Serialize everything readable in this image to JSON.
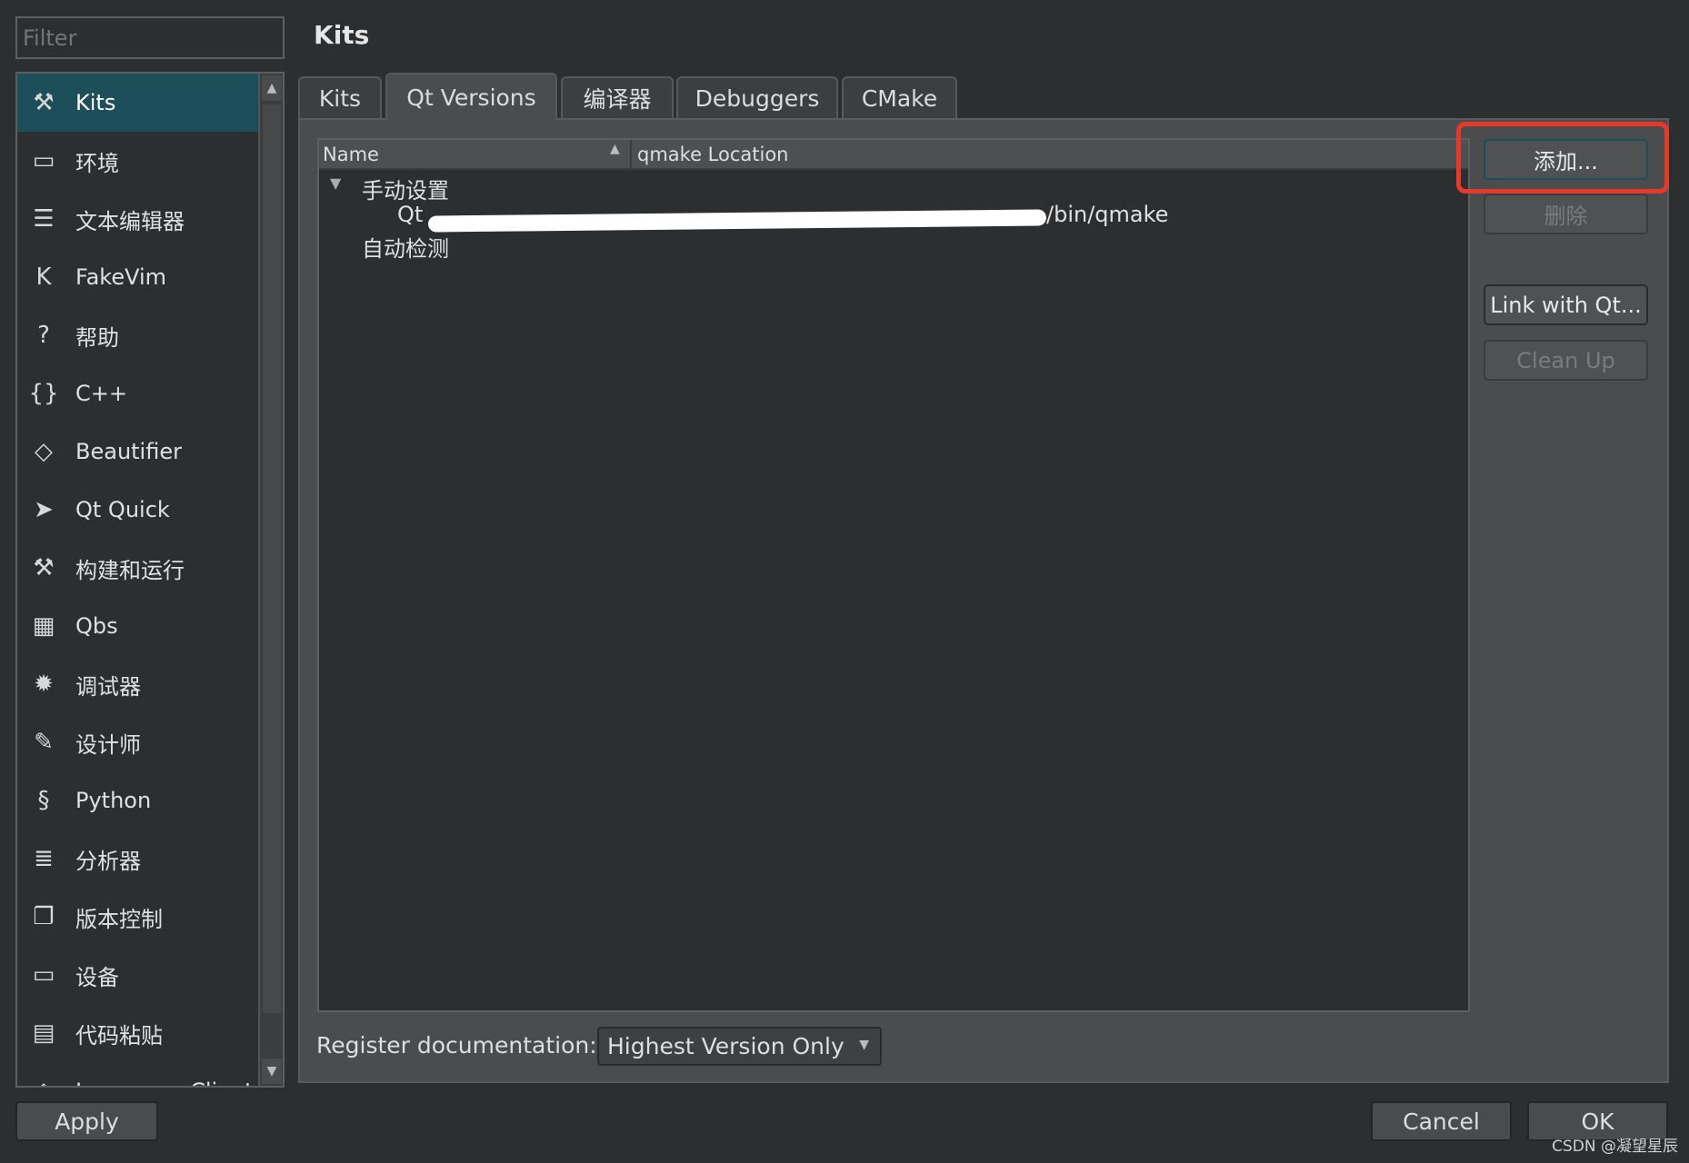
{
  "filter": {
    "placeholder": "Filter"
  },
  "title": "Kits",
  "sidebar": {
    "items": [
      {
        "label": "Kits",
        "icon": "kits-icon"
      },
      {
        "label": "环境",
        "icon": "monitor-icon"
      },
      {
        "label": "文本编辑器",
        "icon": "text-editor-icon"
      },
      {
        "label": "FakeVim",
        "icon": "fakevim-icon"
      },
      {
        "label": "帮助",
        "icon": "help-icon"
      },
      {
        "label": "C++",
        "icon": "braces-icon"
      },
      {
        "label": "Beautifier",
        "icon": "diamond-icon"
      },
      {
        "label": "Qt Quick",
        "icon": "paper-plane-icon"
      },
      {
        "label": "构建和运行",
        "icon": "hammer-icon"
      },
      {
        "label": "Qbs",
        "icon": "grid-icon"
      },
      {
        "label": "调试器",
        "icon": "bug-icon"
      },
      {
        "label": "设计师",
        "icon": "pencil-icon"
      },
      {
        "label": "Python",
        "icon": "python-icon"
      },
      {
        "label": "分析器",
        "icon": "analyzer-icon"
      },
      {
        "label": "版本控制",
        "icon": "files-icon"
      },
      {
        "label": "设备",
        "icon": "device-icon"
      },
      {
        "label": "代码粘贴",
        "icon": "clipboard-icon"
      },
      {
        "label": "Language Client",
        "icon": "language-client-icon"
      }
    ],
    "selected": "Kits"
  },
  "tabs": [
    {
      "label": "Kits"
    },
    {
      "label": "Qt Versions",
      "selected": true
    },
    {
      "label": "编译器"
    },
    {
      "label": "Debuggers"
    },
    {
      "label": "CMake"
    }
  ],
  "tree": {
    "columns": [
      "Name",
      "qmake Location"
    ],
    "groups": [
      {
        "label": "手动设置",
        "expanded": true,
        "children": [
          {
            "name": "Qt",
            "location": "/bin/qmake",
            "redacted": true
          }
        ]
      },
      {
        "label": "自动检测"
      }
    ]
  },
  "buttons": {
    "add": "添加...",
    "remove": "删除",
    "link": "Link with Qt...",
    "cleanup": "Clean Up"
  },
  "register": {
    "label": "Register documentation:",
    "value": "Highest Version Only"
  },
  "footer": {
    "apply": "Apply",
    "cancel": "Cancel",
    "ok": "OK"
  },
  "watermark": "CSDN @凝望星辰",
  "colors": {
    "selection": "#1d4f5a",
    "highlight": "#e53a2a"
  }
}
